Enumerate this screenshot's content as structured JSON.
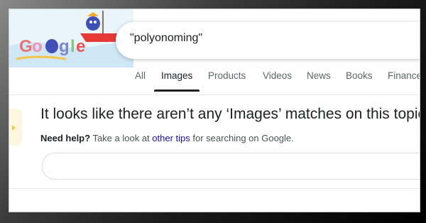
{
  "doodle": {
    "label": "Google doodle"
  },
  "search": {
    "query": "\"polyonoming\""
  },
  "tabs": [
    {
      "label": "All"
    },
    {
      "label": "Images"
    },
    {
      "label": "Products"
    },
    {
      "label": "Videos"
    },
    {
      "label": "News"
    },
    {
      "label": "Books"
    },
    {
      "label": "Finance"
    }
  ],
  "message": {
    "heading": "It looks like there aren’t any ‘Images’ matches on this topic",
    "help_prefix": "Need help?",
    "help_mid": " Take a look at ",
    "help_link": "other tips",
    "help_suffix": " for searching on Google."
  },
  "colors": {
    "link": "#1a0dab",
    "text": "#202124",
    "muted": "#5f6368"
  }
}
